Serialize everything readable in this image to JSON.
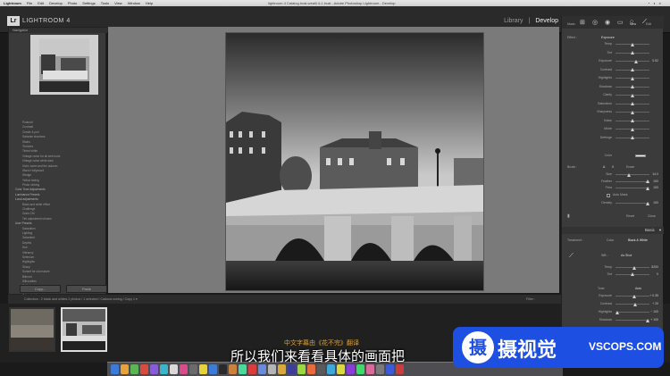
{
  "menubar": {
    "app": "Lightroom",
    "items": [
      "File",
      "Edit",
      "Develop",
      "Photo",
      "Settings",
      "Tools",
      "View",
      "Window",
      "Help"
    ],
    "window_title": "lightroom 4 Catalog.lrcat-weaili 4-1.lrcat - Adobe Photoshop Lightroom - Develop"
  },
  "topbar": {
    "logo": "Lr",
    "app_title": "LIGHTROOM 4",
    "modules": [
      "Library",
      "Develop"
    ],
    "active_module": "Develop"
  },
  "left_panel": {
    "navigator": "Navigator",
    "presets": [
      {
        "label": "Polaroid",
        "folder": false
      },
      {
        "label": "Contrast",
        "folder": false
      },
      {
        "label": "Create & pull",
        "folder": false
      },
      {
        "label": "Saturate shadows",
        "folder": false
      },
      {
        "label": "Stains",
        "folder": false
      },
      {
        "label": "Textures",
        "folder": false
      },
      {
        "label": "Tinted white",
        "folder": false
      },
      {
        "label": "Vintage noise for all web tools",
        "folder": false
      },
      {
        "label": "Vintage noise white dark",
        "folder": false
      },
      {
        "label": "Vivid, warm and the autumn",
        "folder": false
      },
      {
        "label": "Warm Hollywood",
        "folder": false
      },
      {
        "label": "Wedge",
        "folder": false
      },
      {
        "label": "Yellow fading",
        "folder": false
      },
      {
        "label": "Photo vinking",
        "folder": false
      },
      {
        "label": "Color Tone Adjustments",
        "folder": true
      },
      {
        "label": "Luminance Presets",
        "folder": true
      },
      {
        "label": "Local adjustments",
        "folder": true
      },
      {
        "label": "Black and white effect",
        "folder": false
      },
      {
        "label": "Challenge",
        "folder": false
      },
      {
        "label": "Grain CM",
        "folder": false
      },
      {
        "label": "Tint adjustment chosen",
        "folder": false
      },
      {
        "label": "User Presets",
        "folder": true
      },
      {
        "label": "Saturation",
        "folder": false
      },
      {
        "label": "Lighting",
        "folder": false
      },
      {
        "label": "Saturated",
        "folder": false
      },
      {
        "label": "Depths",
        "folder": false
      },
      {
        "label": "Hue",
        "folder": false
      },
      {
        "label": "Vibrancy",
        "folder": false
      },
      {
        "label": "Selenium",
        "folder": false
      },
      {
        "label": "Highlights",
        "folder": false
      },
      {
        "label": "Sharp",
        "folder": false
      },
      {
        "label": "Sunset for old mature",
        "folder": false
      },
      {
        "label": "Bilmont",
        "folder": false
      },
      {
        "label": "Silhouettes",
        "folder": false
      },
      {
        "label": "Split shade",
        "folder": false
      },
      {
        "label": "Overlay colors",
        "folder": false
      },
      {
        "label": "Color shading",
        "folder": false
      }
    ],
    "copy_label": "Copy...",
    "paste_label": "Paste"
  },
  "toolbar": {
    "info": "Collection : 2 black and whites    2 photos / 1 selected / Cadona zoning / Copy 1 ▾",
    "filter": "Filter :"
  },
  "right_panel": {
    "mask": {
      "label": "Mask :",
      "new": "New",
      "edit": "Edit"
    },
    "effect": {
      "label": "Effect :",
      "value": "Exposure"
    },
    "sliders_top": [
      {
        "label": "Temp",
        "pos": 0.5,
        "value": ""
      },
      {
        "label": "Tint",
        "pos": 0.5,
        "value": ""
      },
      {
        "label": "Exposure",
        "pos": 0.6,
        "value": "0.52"
      },
      {
        "label": "Contrast",
        "pos": 0.5,
        "value": ""
      },
      {
        "label": "Highlights",
        "pos": 0.5,
        "value": ""
      },
      {
        "label": "Shadows",
        "pos": 0.5,
        "value": ""
      },
      {
        "label": "Clarity",
        "pos": 0.5,
        "value": ""
      },
      {
        "label": "Saturation",
        "pos": 0.5,
        "value": ""
      },
      {
        "label": "Sharpness",
        "pos": 0.5,
        "value": ""
      },
      {
        "label": "Noise",
        "pos": 0.5,
        "value": ""
      },
      {
        "label": "Moire",
        "pos": 0.5,
        "value": ""
      },
      {
        "label": "Defringe",
        "pos": 0.5,
        "value": ""
      }
    ],
    "color": "Color",
    "brush": {
      "label": "Brush :",
      "a": "A",
      "b": "B",
      "erase": "Erase"
    },
    "brush_sliders": [
      {
        "label": "Size",
        "pos": 0.4,
        "value": "14.0"
      },
      {
        "label": "Feather",
        "pos": 0.95,
        "value": "100"
      },
      {
        "label": "Flow",
        "pos": 0.95,
        "value": "100"
      }
    ],
    "auto_mask": "Auto Mask",
    "density": {
      "label": "Density",
      "pos": 0.95,
      "value": "100"
    },
    "reset": "Reset",
    "close": "Close",
    "basic": "Basic",
    "treatment": {
      "label": "Treatment :",
      "color": "Color",
      "bw": "Black & White"
    },
    "wb": {
      "label": "WB :",
      "value": "As Shot"
    },
    "wb_sliders": [
      {
        "label": "Temp",
        "pos": 0.55,
        "value": "5200"
      },
      {
        "label": "Tint",
        "pos": 0.5,
        "value": "0"
      }
    ],
    "tone": {
      "label": "Tone",
      "auto": "Auto"
    },
    "tone_sliders": [
      {
        "label": "Exposure",
        "pos": 0.55,
        "value": "+ 0.35"
      },
      {
        "label": "Contrast",
        "pos": 0.58,
        "value": "+ 20"
      },
      {
        "label": "Highlights",
        "pos": 0.05,
        "value": "− 100"
      },
      {
        "label": "Shadows",
        "pos": 0.95,
        "value": "+ 100"
      }
    ]
  },
  "subtitles": {
    "small": "中文字幕由《花不完》翻译",
    "main": "所以我们来看看具体的画面把"
  },
  "watermark": {
    "icon": "摄",
    "cn": "摄视觉",
    "en": "VSCOPS.COM"
  },
  "colors": {
    "watermark_blue": "#1e4fe3",
    "subtitle_orange": "#d9a23a"
  }
}
